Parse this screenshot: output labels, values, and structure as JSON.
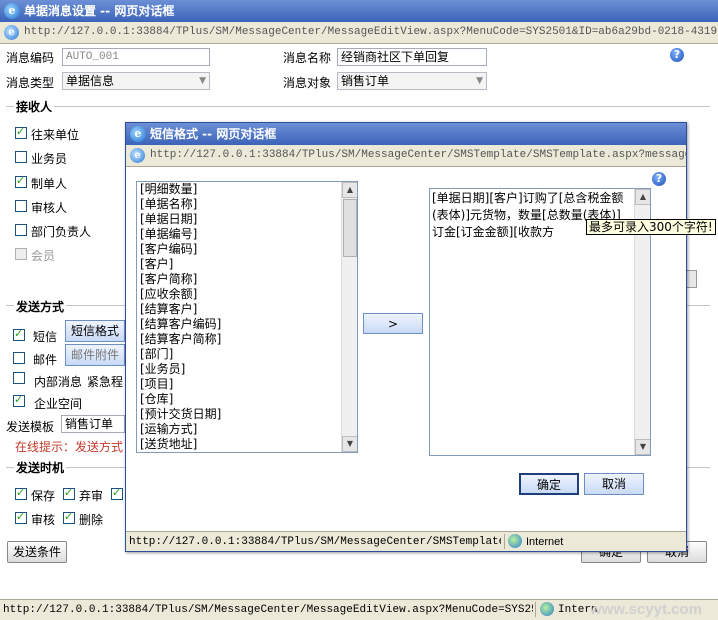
{
  "outer": {
    "title": "单据消息设置 -- 网页对话框",
    "url": "http://127.0.0.1:33884/TPlus/SM/MessageCenter/MessageEditView.aspx?MenuCode=SYS2501&ID=ab6a29bd-0218-4319-b1ac-4f9",
    "status_url": "http://127.0.0.1:33884/TPlus/SM/MessageCenter/MessageEditView.aspx?MenuCode=SYS2501&ID=ab",
    "status_zone": "Intern",
    "watermark": "www.scyyt.com",
    "form": {
      "code_label": "消息编码",
      "code_value": "AUTO_001",
      "name_label": "消息名称",
      "name_value": "经销商社区下单回复",
      "type_label": "消息类型",
      "type_value": "单据信息",
      "target_label": "消息对象",
      "target_value": "销售订单"
    },
    "receivers": {
      "title": "接收人",
      "items": [
        {
          "label": "往来单位",
          "checked": true
        },
        {
          "label": "业务员",
          "checked": false
        },
        {
          "label": "制单人",
          "checked": true
        },
        {
          "label": "审核人",
          "checked": false
        },
        {
          "label": "部门负责人",
          "checked": false
        },
        {
          "label": "会员",
          "checked": false
        }
      ]
    },
    "send_method": {
      "title": "发送方式",
      "sms_label": "短信",
      "sms_button": "短信格式",
      "mail_label": "邮件",
      "mail_button": "邮件附件",
      "internal_label": "内部消息",
      "urgent_label": "紧急程",
      "enterprise_label": "企业空间",
      "template_label": "发送模板",
      "template_value": "销售订单",
      "online_hint": "在线提示：发送方式"
    },
    "send_time": {
      "title": "发送时机",
      "save": "保存",
      "abandon": "弃审",
      "audit": "审核",
      "delete": "删除"
    },
    "send_condition_button": "发送条件",
    "ok_button": "确定",
    "cancel_button": "取消"
  },
  "dialog": {
    "title": "短信格式 -- 网页对话框",
    "url": "http://127.0.0.1:33884/TPlus/SM/MessageCenter/SMSTemplate/SMSTemplate.aspx?messageRule=V",
    "status_url": "http://127.0.0.1:33884/TPlus/SM/MessageCenter/SMSTemplate/SMST",
    "status_zone": "Internet",
    "fields": [
      "[明细数量]",
      "[单据名称]",
      "[单据日期]",
      "[单据编号]",
      "[客户编码]",
      "[客户]",
      "[客户简称]",
      "[应收余额]",
      "[结算客户]",
      "[结算客户编码]",
      "[结算客户简称]",
      "[部门]",
      "[业务员]",
      "[项目]",
      "[仓库]",
      "[预计交货日期]",
      "[运输方式]",
      "[送货地址]"
    ],
    "add_button": ">",
    "template_text": "[单据日期][客户]订购了[总含税金额(表体)]元货物，数量[总数量(表体)]订金[订金金额][收款方",
    "tooltip": "最多可录入300个字符!",
    "ok_button": "确定",
    "cancel_button": "取消"
  }
}
